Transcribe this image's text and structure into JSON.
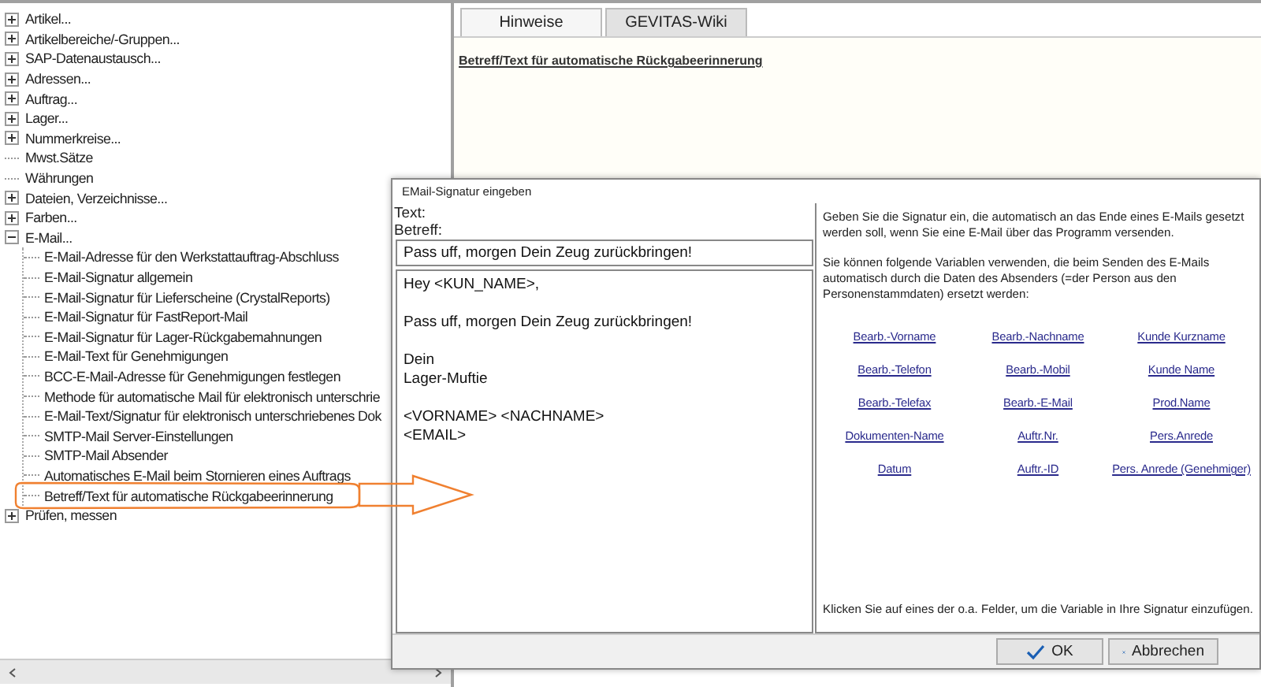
{
  "tree": {
    "items": [
      {
        "label": "Artikel...",
        "kind": "group",
        "expanded": false
      },
      {
        "label": "Artikelbereiche/-Gruppen...",
        "kind": "group",
        "expanded": false
      },
      {
        "label": "SAP-Datenaustausch...",
        "kind": "group",
        "expanded": false
      },
      {
        "label": "Adressen...",
        "kind": "group",
        "expanded": false
      },
      {
        "label": "Auftrag...",
        "kind": "group",
        "expanded": false
      },
      {
        "label": "Lager...",
        "kind": "group",
        "expanded": false
      },
      {
        "label": "Nummerkreise...",
        "kind": "group",
        "expanded": false
      },
      {
        "label": "Mwst.Sätze",
        "kind": "leaf"
      },
      {
        "label": "Währungen",
        "kind": "leaf"
      },
      {
        "label": "Dateien, Verzeichnisse...",
        "kind": "group",
        "expanded": false
      },
      {
        "label": "Farben...",
        "kind": "group",
        "expanded": false
      },
      {
        "label": "E-Mail...",
        "kind": "group",
        "expanded": true,
        "children": [
          {
            "label": "E-Mail-Adresse für den Werkstattauftrag-Abschluss",
            "kind": "leaf"
          },
          {
            "label": "E-Mail-Signatur allgemein",
            "kind": "leaf"
          },
          {
            "label": "E-Mail-Signatur für Lieferscheine (CrystalReports)",
            "kind": "leaf"
          },
          {
            "label": "E-Mail-Signatur für FastReport-Mail",
            "kind": "leaf"
          },
          {
            "label": "E-Mail-Signatur für Lager-Rückgabemahnungen",
            "kind": "leaf"
          },
          {
            "label": "E-Mail-Text für Genehmigungen",
            "kind": "leaf"
          },
          {
            "label": "BCC-E-Mail-Adresse für Genehmigungen festlegen",
            "kind": "leaf"
          },
          {
            "label": "Methode für automatische Mail für elektronisch unterschrie",
            "kind": "leaf"
          },
          {
            "label": "E-Mail-Text/Signatur für elektronisch unterschriebenes Dok",
            "kind": "leaf"
          },
          {
            "label": "SMTP-Mail Server-Einstellungen",
            "kind": "leaf"
          },
          {
            "label": "SMTP-Mail Absender",
            "kind": "leaf"
          },
          {
            "label": "Automatisches E-Mail beim Stornieren eines Auftrags",
            "kind": "leaf"
          },
          {
            "label": "Betreff/Text für automatische Rückgabeerinnerung",
            "kind": "leaf"
          }
        ]
      },
      {
        "label": "Prüfen, messen",
        "kind": "group",
        "expanded": false
      }
    ]
  },
  "tabs": [
    {
      "label": "Hinweise",
      "selected": true
    },
    {
      "label": "GEVITAS-Wiki",
      "selected": false
    }
  ],
  "hint_link": "Betreff/Text für automatische Rückgabeerinnerung",
  "dialog": {
    "title": "EMail-Signatur eingeben",
    "text_label": "Text:",
    "subject_label": "Betreff:",
    "subject_value": "Pass uff, morgen Dein Zeug zurückbringen!",
    "body_value": "Hey <KUN_NAME>,\n\nPass uff, morgen Dein Zeug zurückbringen!\n\nDein\nLager-Muftie\n\n<VORNAME> <NACHNAME>\n<EMAIL>",
    "intro": "Geben Sie die Signatur ein, die automatisch an das Ende eines E-Mails gesetzt werden soll, wenn Sie eine E-Mail über das Programm versenden.",
    "variables_intro": "Sie können folgende Variablen verwenden, die beim Senden des E-Mails automatisch durch die Daten des Absenders (=der Person aus den Personenstammdaten) ersetzt werden:",
    "variable_links": [
      "Bearb.-Vorname",
      "Bearb.-Nachname",
      "Kunde Kurzname",
      "Bearb.-Telefon",
      "Bearb.-Mobil",
      "Kunde Name",
      "Bearb.-Telefax",
      "Bearb.-E-Mail",
      "Prod.Name",
      "Dokumenten-Name",
      "Auftr.Nr.",
      "Pers.Anrede",
      "Datum",
      "Auftr.-ID",
      "Pers. Anrede (Genehmiger)"
    ],
    "footer_hint": "Klicken Sie auf eines der o.a. Felder, um die Variable in Ihre Signatur einzufügen.",
    "buttons": [
      {
        "label": "OK",
        "kind": "ok"
      },
      {
        "label": "Abbrechen",
        "kind": "cancel"
      }
    ]
  }
}
